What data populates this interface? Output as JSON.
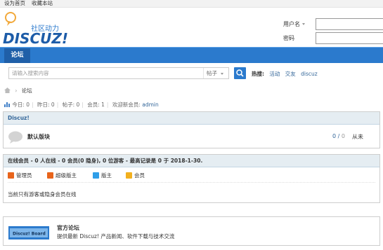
{
  "topbar": {
    "set_home": "设为首页",
    "bookmark": "收藏本站"
  },
  "logo": {
    "tagline": "社区动力",
    "wordmark": "DISCUZ!"
  },
  "login": {
    "username_label": "用户名",
    "password_label": "密码"
  },
  "nav": {
    "active_tab": "论坛"
  },
  "search": {
    "placeholder": "请输入搜索内容",
    "type": "帖子",
    "hot_label": "热搜:",
    "hot_words": [
      "活动",
      "交友",
      "discuz"
    ]
  },
  "breadcrumb": {
    "current": "论坛"
  },
  "stats": {
    "today": "今日: 0",
    "yesterday": "昨日: 0",
    "posts": "帖子: 0",
    "members": "会员: 1",
    "welcome_prefix": "欢迎新会员: ",
    "newest_member": "admin"
  },
  "category": {
    "title": "Discuz!",
    "forums": [
      {
        "name": "默认版块",
        "threads": "0",
        "posts": "0",
        "last_post": "从未"
      }
    ]
  },
  "online": {
    "header": "在线会员 - 0 人在线 - 0 会员(0 隐身), 0 位游客 - 最高记录是 0 于 2018-1-30.",
    "legend": [
      {
        "label": "管理员",
        "color": "#e8641b"
      },
      {
        "label": "超级版主",
        "color": "#e8641b"
      },
      {
        "label": "版主",
        "color": "#2f9ee8"
      },
      {
        "label": "会员",
        "color": "#f2b01e"
      }
    ],
    "note": "当前只有游客或隐身会员在线"
  },
  "links": [
    {
      "title": "官方论坛",
      "desc": "提供最新 Discuz! 产品新闻、软件下载与技术交流",
      "badge": "Discuz! Board"
    }
  ],
  "colors": {
    "nav_blue": "#2b7acd",
    "link": "#336699",
    "head_bg": "#e5edf2"
  }
}
